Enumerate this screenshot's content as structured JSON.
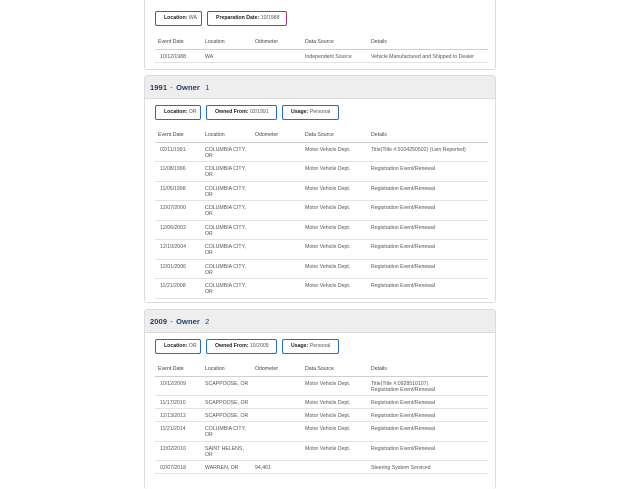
{
  "columns": [
    "Event Date",
    "Location",
    "Odometer",
    "Data Source",
    "Details"
  ],
  "sections": [
    {
      "chips": [
        {
          "label": "Location:",
          "value": "WA"
        },
        {
          "label": "Preparation Date:",
          "value": "10/1988"
        }
      ],
      "rows": [
        {
          "date": "10/12/1988",
          "location": "WA",
          "odometer": "",
          "source": "Independent Source",
          "details": "Vehicle Manufactured and Shipped to Dealer"
        }
      ]
    },
    {
      "header": {
        "year": "1991",
        "owner_label": "Owner",
        "owner_num": "1"
      },
      "chips": [
        {
          "label": "Location:",
          "value": "OR"
        },
        {
          "label": "Owned From:",
          "value": "02/1991"
        },
        {
          "label": "Usage:",
          "value": "Personal"
        }
      ],
      "rows": [
        {
          "date": "02/11/1991",
          "location": "COLUMBIA CITY,\nOR",
          "odometer": "",
          "source": "Motor Vehicle Dept.",
          "details": "Title(Title #:9104250502) (Lien Reported)"
        },
        {
          "date": "11/08/1996",
          "location": "COLUMBIA CITY,\nOR",
          "odometer": "",
          "source": "Motor Vehicle Dept.",
          "details": "Registration Event/Renewal"
        },
        {
          "date": "11/05/1998",
          "location": "COLUMBIA CITY,\nOR",
          "odometer": "",
          "source": "Motor Vehicle Dept.",
          "details": "Registration Event/Renewal"
        },
        {
          "date": "12/07/2000",
          "location": "COLUMBIA CITY,\nOR",
          "odometer": "",
          "source": "Motor Vehicle Dept.",
          "details": "Registration Event/Renewal"
        },
        {
          "date": "12/06/2002",
          "location": "COLUMBIA CITY,\nOR",
          "odometer": "",
          "source": "Motor Vehicle Dept.",
          "details": "Registration Event/Renewal"
        },
        {
          "date": "12/10/2004",
          "location": "COLUMBIA CITY,\nOR",
          "odometer": "",
          "source": "Motor Vehicle Dept.",
          "details": "Registration Event/Renewal"
        },
        {
          "date": "12/01/2006",
          "location": "COLUMBIA CITY,\nOR",
          "odometer": "",
          "source": "Motor Vehicle Dept.",
          "details": "Registration Event/Renewal"
        },
        {
          "date": "11/21/2008",
          "location": "COLUMBIA CITY,\nOR",
          "odometer": "",
          "source": "Motor Vehicle Dept.",
          "details": "Registration Event/Renewal"
        }
      ]
    },
    {
      "header": {
        "year": "2009",
        "owner_label": "Owner",
        "owner_num": "2"
      },
      "chips": [
        {
          "label": "Location:",
          "value": "OR"
        },
        {
          "label": "Owned From:",
          "value": "10/2009"
        },
        {
          "label": "Usage:",
          "value": "Personal"
        }
      ],
      "rows": [
        {
          "date": "10/12/2009",
          "location": "SCAPPOOSE, OR",
          "odometer": "",
          "source": "Motor Vehicle Dept.",
          "details": "Title(Title #:0928510107)\nRegistration Event/Renewal"
        },
        {
          "date": "11/17/2010",
          "location": "SCAPPOOSE, OR",
          "odometer": "",
          "source": "Motor Vehicle Dept.",
          "details": "Registration Event/Renewal"
        },
        {
          "date": "12/13/2012",
          "location": "SCAPPOOSE, OR",
          "odometer": "",
          "source": "Motor Vehicle Dept.",
          "details": "Registration Event/Renewal"
        },
        {
          "date": "11/21/2014",
          "location": "COLUMBIA CITY,\nOR",
          "odometer": "",
          "source": "Motor Vehicle Dept.",
          "details": "Registration Event/Renewal"
        },
        {
          "date": "12/02/2016",
          "location": "SAINT HELENS,\nOR",
          "odometer": "",
          "source": "Motor Vehicle Dept.",
          "details": "Registration Event/Renewal"
        },
        {
          "date": "02/07/2018",
          "location": "WARREN, OR",
          "odometer": "94,461",
          "source": "",
          "details": "Steering System Serviced"
        }
      ]
    }
  ],
  "colors": {
    "chip_border": "#2a6fb0",
    "chip_border_accent": "#a3357e",
    "header_text": "#1f3f73"
  }
}
